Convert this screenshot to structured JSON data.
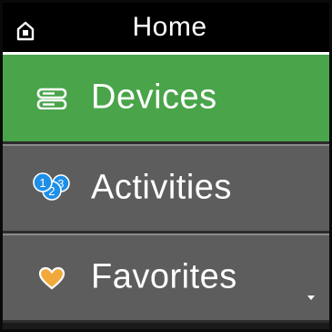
{
  "header": {
    "title": "Home",
    "home_icon": "home-icon"
  },
  "menu": {
    "items": [
      {
        "label": "Devices",
        "icon": "devices-icon",
        "selected": true
      },
      {
        "label": "Activities",
        "icon": "activities-icon",
        "selected": false
      },
      {
        "label": "Favorites",
        "icon": "heart-icon",
        "selected": false
      }
    ]
  },
  "colors": {
    "selected_bg": "#4aa44a",
    "item_bg": "#5d5d5d",
    "header_bg": "#000000",
    "icon_blue": "#1e8fe8",
    "heart_orange": "#f2a93b"
  }
}
